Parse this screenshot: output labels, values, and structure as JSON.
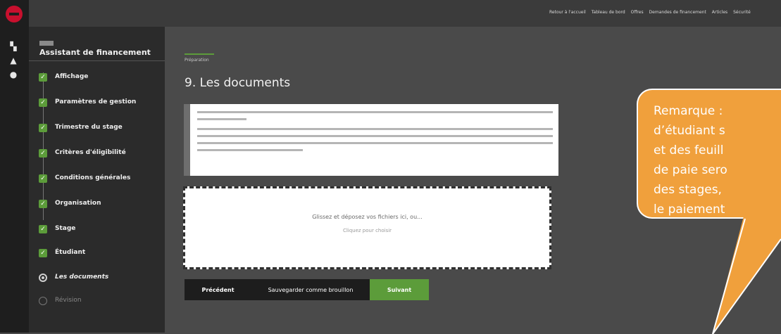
{
  "topbar": {
    "nav_links": [
      "Retour à l'accueil",
      "Tableau de bord",
      "Offres",
      "Demandes de financement",
      "Articles",
      "Sécurité"
    ]
  },
  "rail": {
    "icons": [
      "logo-icon",
      "dashboard-icon",
      "home-icon",
      "user-icon"
    ]
  },
  "sidebar": {
    "badge": "",
    "title": "Assistant de financement",
    "items": [
      {
        "label": "Affichage",
        "state": "done"
      },
      {
        "label": "Paramètres de gestion",
        "state": "done"
      },
      {
        "label": "Trimestre du stage",
        "state": "done"
      },
      {
        "label": "Critères d'éligibilité",
        "state": "done"
      },
      {
        "label": "Conditions générales",
        "state": "done"
      },
      {
        "label": "Organisation",
        "state": "done"
      },
      {
        "label": "Stage",
        "state": "done"
      },
      {
        "label": "Étudiant",
        "state": "done"
      },
      {
        "label": "Les documents",
        "state": "current"
      },
      {
        "label": "Révision",
        "state": "todo"
      }
    ]
  },
  "main": {
    "breadcrumb": "Préparation",
    "page_title": "9. Les documents",
    "dropzone": {
      "main_text": "Glissez et déposez vos fichiers ici, ou...",
      "sub_text": "Cliquez pour choisir"
    },
    "buttons": {
      "prev": "Précédent",
      "draft": "Sauvegarder comme brouillon",
      "next": "Suivant"
    }
  },
  "callout": {
    "text": "Remarque :\nd’étudiant s\net des feuill\nde paie sero\ndes stages,\nle paiement"
  },
  "colors": {
    "accent": "#5c9c3a",
    "callout": "#f0a03c",
    "brand": "#c8102e"
  }
}
